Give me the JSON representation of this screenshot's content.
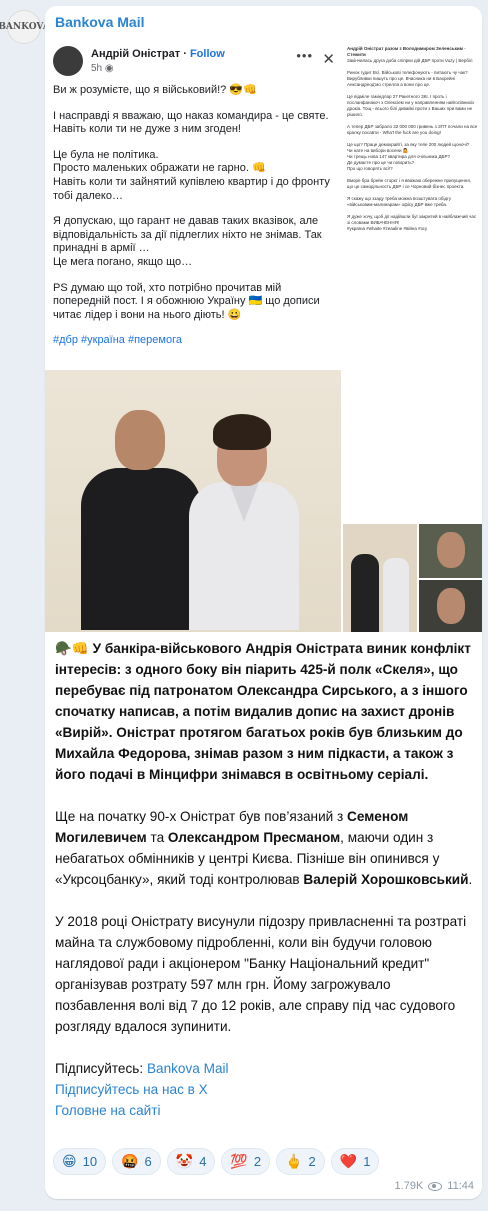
{
  "channel": {
    "avatar_text": "BANKOVA",
    "name": "Bankova Mail"
  },
  "fb_post": {
    "author": "Андрій Оністрат",
    "follow": "Follow",
    "time": "5h",
    "paragraphs": [
      "Ви ж розумієте, що я військовий!? 😎👊",
      "І насправді я вважаю, що наказ командира - це святе. Навіть коли ти не дуже з ним згоден!",
      "Це була не політика.\nПросто маленьких ображати не гарно. 👊\nНавіть коли ти зайнятий купівлею квартир і до фронту тобі далеко…",
      "Я допускаю, що гарант не давав таких вказівок, але відповідальність за дії підлеглих ніхто не знімав. Так принадні в армії …\nЦе мега погано, якщо що…",
      "PS думаю що той, хто потрібно прочитав мій попередній пост. І я обожнюю Україну 🇺🇦 що дописи читає лідер і вони на нього діють! 😀"
    ],
    "tags": "#дбр #україна #перемога"
  },
  "side_post": {
    "header": "Андрій Оністрат разом з Володимиром Зеленським · Стежити",
    "text": "Закінчилась друга доба сліпрки дій ДБР проти Vuzy | Вербіл\n\nРинок гудит Всі. Військові телефонують - питають чу чак? Вирубливки пишуть про це. Вчасника ни в Бахрейні Анксандреод'мо стрелла а вони про це.\n\nЦе відміле гаміндлар 27 Ракетного ЗКІ. І проть і посланфанакоч з Олексіем ни у направленням найголівнихіх дрокіа. Тощ - всього білі дивайкі проти з Ваших при вами не рішило.\n\nА тепер ДБР забрало 32 000 000 гривень з ЗПТ почали на все кралку посавти - Wha't the fuck are you doing!\n\nЦе що? Праце демокрайті, за яку тепе 200 людей щоночі?\nЧи нате на вибори восени 🤷\nЧи трещь нова 147 квартира для очільника ДБР?\nДе думаєте про це чи говорить?\nПро що говорять всі!?\n\nВморе бра брейн сторкт і я вважаю обережне припущення, що це самодільность ДБР і се Чорновий бізнес проекта.\n\nЯ скажу що ззаду треба можна возштувата обідгу «військовим-малинарам» офісу ДБР вже треба.\n\nЯ дуже хочу, щоб дії надійшли буї закритий в найблажчий час зі словами ВИБАЧЕННЯ!\n#україна #whaite #zeaaline #війна #зсу"
  },
  "message": {
    "p1": [
      {
        "t": "🪖👊 У банкіра-військового Андрія Оністрата виник конфлікт інтересів: з одного боку він піарить 425-й полк «Скеля», що перебуває під патронатом Олександра Сирського, а з іншого спочатку написав, а потім видалив допис на захист дронів «Вирій». Оністрат протягом багатьох років був близьким до Михайла Федорова, знімав разом з ним підкасти, а також з його подачі в Мінцифри знімався в освітньому серіалі.",
        "b": true
      }
    ],
    "p2": [
      {
        "t": "Ще на початку 90-х Оністрат був пов’язаний з ",
        "b": false
      },
      {
        "t": "Семеном Могилевичем",
        "b": true
      },
      {
        "t": " та ",
        "b": false
      },
      {
        "t": "Олександром Пресманом",
        "b": true
      },
      {
        "t": ", маючи один з небагатьох обмінників у центрі Києва. Пізніше він опинився у «Укрсоцбанку», який тоді контролював ",
        "b": false
      },
      {
        "t": "Валерій Хорошковський",
        "b": true
      },
      {
        "t": ".",
        "b": false
      }
    ],
    "p3": "У 2018 році Оністрату висунули підозру привласненні та розтраті майна та службовому підробленні, коли він будучи головою наглядової ради і акціонером \"Банку Національний кредит\" організував розтрату 597 млн грн. Йому загрожувало позбавлення волі від 7 до 12 років, але справу під час судового розгляду вдалося зупинити.",
    "subscribe_prefix": "Підписуйтесь: ",
    "subscribe_link": "Bankova Mail",
    "x_link": "Підписуйтесь на нас в Х",
    "site_link": "Головне на сайті"
  },
  "reactions": [
    {
      "emoji": "😁",
      "count": "10"
    },
    {
      "emoji": "🤬",
      "count": "6"
    },
    {
      "emoji": "🤡",
      "count": "4"
    },
    {
      "emoji": "💯",
      "count": "2"
    },
    {
      "emoji": "🖕",
      "count": "2"
    },
    {
      "emoji": "❤️",
      "count": "1"
    }
  ],
  "footer": {
    "views": "1.79K",
    "time": "11:44"
  },
  "colors": {
    "accent": "#2a84d1",
    "background": "#e8eef3",
    "bubble": "#ffffff",
    "fb_link": "#1b74e4"
  }
}
